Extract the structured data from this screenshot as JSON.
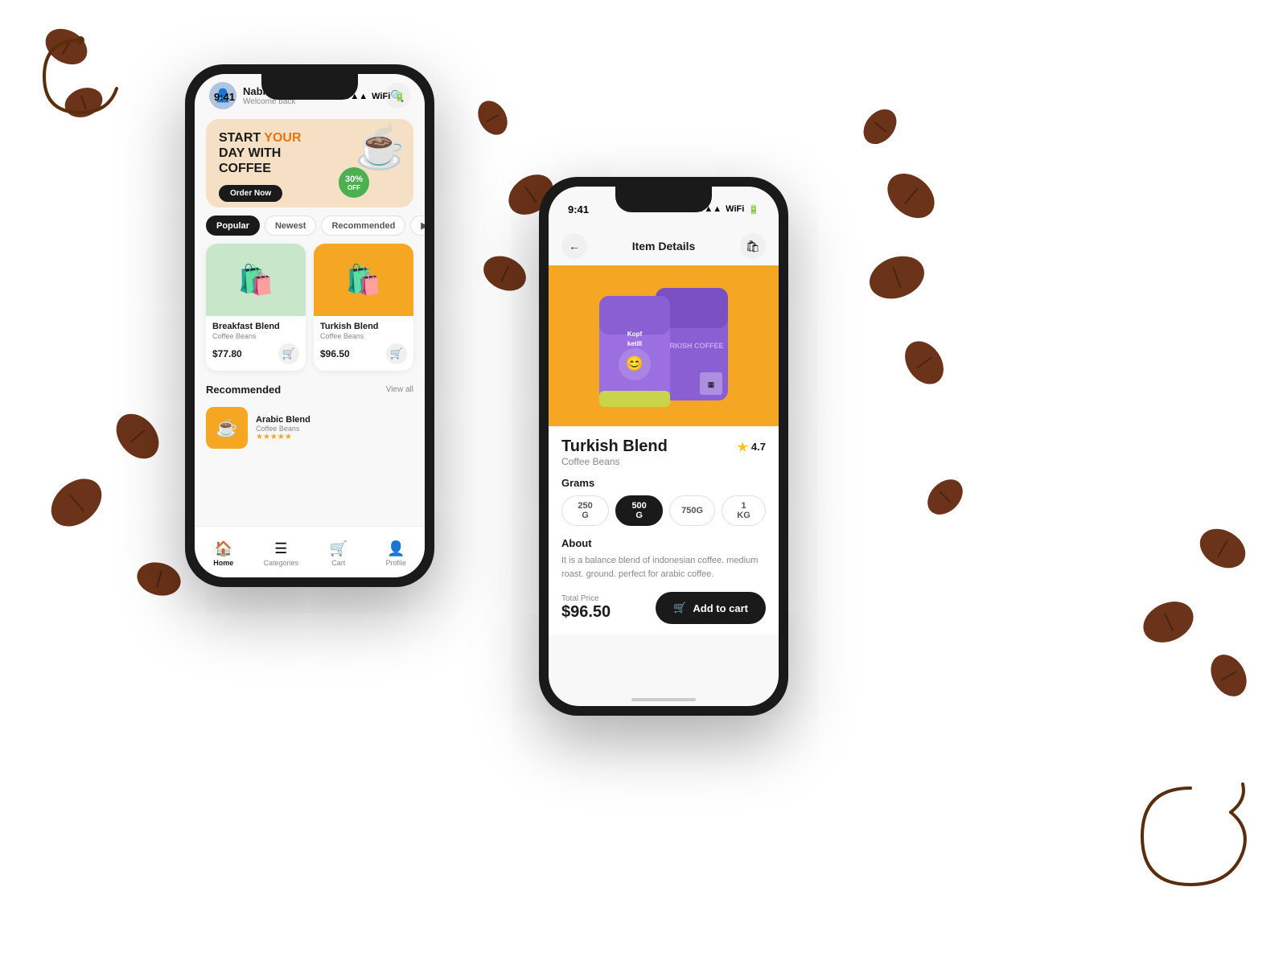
{
  "page": {
    "background": "#ffffff"
  },
  "phone1": {
    "status_time": "9:41",
    "user": {
      "name": "Nabil Elsawy",
      "welcome": "Welcome back"
    },
    "banner": {
      "line1": "START ",
      "line1_accent": "YOUR",
      "line2": "DAY WITH",
      "line3": "COFFEE",
      "btn_label": "Order Now",
      "badge_text": "30%\nOFF"
    },
    "tabs": [
      {
        "label": "Popular",
        "active": true
      },
      {
        "label": "Newest",
        "active": false
      },
      {
        "label": "Recommended",
        "active": false
      }
    ],
    "products": [
      {
        "name": "Breakfast Blend",
        "sub": "Coffee Beans",
        "price": "$77.80",
        "bg": "green"
      },
      {
        "name": "Turkish Blend",
        "sub": "Coffee Beans",
        "price": "$96.50",
        "bg": "orange"
      }
    ],
    "recommended_section": {
      "title": "Recommended",
      "view_all": "View all"
    },
    "recommended_item": {
      "name": "Arabic Blend",
      "sub": "Coffee Beans"
    },
    "nav": [
      {
        "label": "Home",
        "icon": "🏠",
        "active": true
      },
      {
        "label": "Categories",
        "icon": "☰",
        "active": false
      },
      {
        "label": "Cart",
        "icon": "🛒",
        "active": false
      },
      {
        "label": "Profile",
        "icon": "👤",
        "active": false
      }
    ]
  },
  "phone2": {
    "status_time": "9:41",
    "header_title": "Item Details",
    "back_icon": "←",
    "bag_icon": "🛍",
    "product": {
      "name": "Turkish Blend",
      "sub": "Coffee Beans",
      "rating": "4.7",
      "grams_label": "Grams",
      "grams": [
        {
          "label": "250 G",
          "selected": false
        },
        {
          "label": "500 G",
          "selected": true
        },
        {
          "label": "750G",
          "selected": false
        },
        {
          "label": "1 KG",
          "selected": false
        }
      ],
      "about_label": "About",
      "about_text": "It is a balance blend of indonesian coffee. medium roast. ground. perfect for arabic coffee.",
      "total_price_label": "Total Price",
      "total_price": "$96.50",
      "add_to_cart": "Add to cart"
    }
  }
}
